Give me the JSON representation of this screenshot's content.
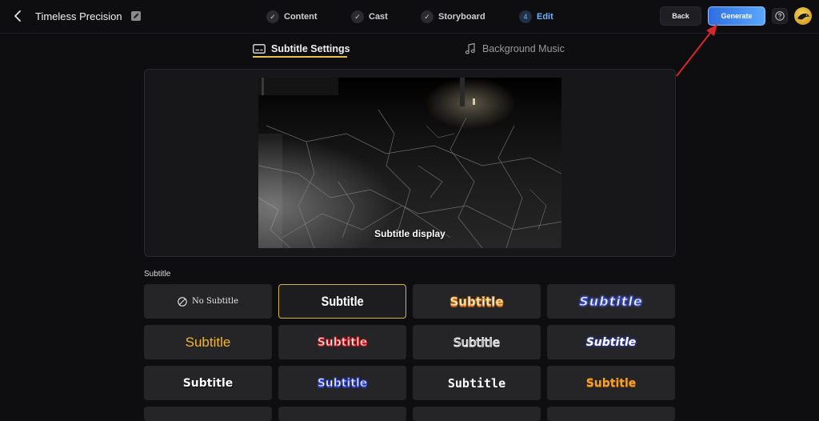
{
  "header": {
    "title": "Timeless Precision",
    "steps": [
      {
        "label": "Content",
        "marker": "✓"
      },
      {
        "label": "Cast",
        "marker": "✓"
      },
      {
        "label": "Storyboard",
        "marker": "✓"
      },
      {
        "label": "Edit",
        "marker": "4"
      }
    ],
    "back_label": "Back",
    "generate_label": "Generate",
    "accent": "#6fb2ff"
  },
  "tabs": [
    {
      "label": "Subtitle Settings",
      "icon": "subtitle-icon"
    },
    {
      "label": "Background Music",
      "icon": "music-note-icon"
    }
  ],
  "preview": {
    "subtitle_text": "Subtitle display"
  },
  "subtitle_section": {
    "label": "Subtitle",
    "options": [
      {
        "text": "No Subtitle"
      },
      {
        "text": "Subtitle"
      },
      {
        "text": "Subtitle"
      },
      {
        "text": "Subtitle"
      },
      {
        "text": "Subtitle"
      },
      {
        "text": "Subtitle"
      },
      {
        "text": "Subtitle"
      },
      {
        "text": "Subtitle"
      },
      {
        "text": "Subtitle"
      },
      {
        "text": "Subtitle"
      },
      {
        "text": "Subtitle"
      },
      {
        "text": "Subtitle"
      }
    ]
  }
}
